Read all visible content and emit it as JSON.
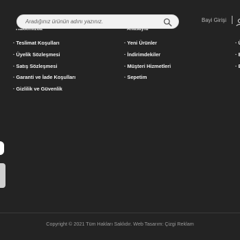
{
  "header": {
    "search_placeholder": "Aradığınız ürünün adını yazınız.",
    "dealer_login": "Bayi Girişi"
  },
  "footer": {
    "col1_cut_item": "· Hakkımızda",
    "col2_cut_item": "· Anasayfa",
    "col1": [
      "· Teslimat Koşulları",
      "· Üyelik Sözleşmesi",
      "· Satış Sözleşmesi",
      "· Garanti ve İade Koşulları",
      "· Gizlilik ve Güvenlik"
    ],
    "col2": [
      "· Yeni Ürünler",
      "· İndirimdekiler",
      "· Müşteri Hizmetleri",
      "· Sepetim"
    ],
    "col3": [
      "· Ü",
      "· E",
      "· E"
    ],
    "copyright": "Copyright © 2021 Tüm Hakları Saklıdır. Web Tasarım: Çizgi Reklam"
  },
  "colors": {
    "background": "#232323",
    "text": "#f0f0f0",
    "muted": "#9a9a9a"
  }
}
